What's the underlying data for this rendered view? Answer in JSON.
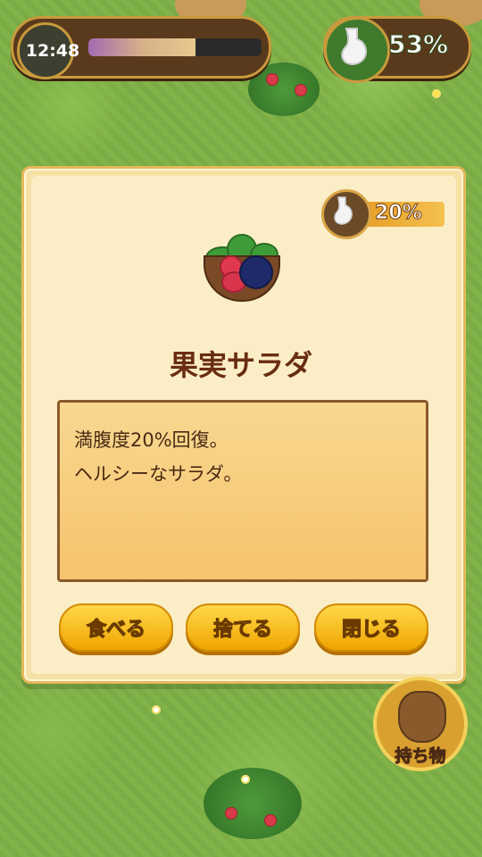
{
  "hud": {
    "time": "12:48",
    "time_progress_fraction": 0.62,
    "stomach_percent": "53%"
  },
  "item": {
    "name": "果実サラダ",
    "fullness_gain": "20%",
    "description_lines": [
      "満腹度20%回復。",
      "ヘルシーなサラダ。"
    ],
    "icon": "fruit-salad-icon"
  },
  "actions": {
    "eat_label": "食べる",
    "discard_label": "捨てる",
    "close_label": "閉じる"
  },
  "inventory": {
    "label": "持ち物",
    "icon": "bag-icon"
  },
  "colors": {
    "button": "#f0a500",
    "panel": "#f5e1a6",
    "title": "#6a2d10"
  }
}
